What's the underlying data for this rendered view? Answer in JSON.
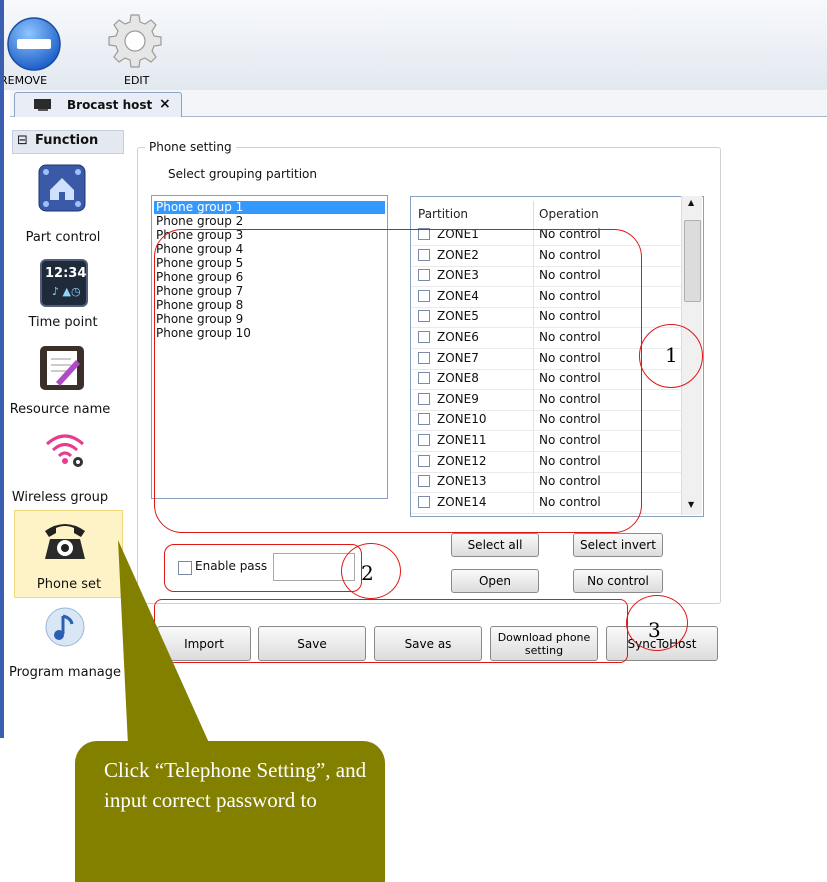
{
  "toolbar": {
    "remove_label": "REMOVE",
    "edit_label": "EDIT"
  },
  "tab": {
    "title": "Brocast host",
    "close": "×"
  },
  "sidebar": {
    "header": "Function",
    "collapse_symbol": "⊟",
    "items": [
      {
        "label": "Part control",
        "icon": "house-network-icon"
      },
      {
        "label": "Time point",
        "icon": "clock-icon",
        "clock_text": "12:34"
      },
      {
        "label": "Resource name",
        "icon": "notepad-icon"
      },
      {
        "label": "Wireless group",
        "icon": "wireless-icon"
      },
      {
        "label": "Phone set",
        "icon": "telephone-icon"
      },
      {
        "label": "Program manage",
        "icon": "music-note-icon"
      }
    ]
  },
  "panel": {
    "legend": "Phone setting",
    "hint": "Select grouping partition",
    "groups": [
      "Phone group 1",
      "Phone group 2",
      "Phone group 3",
      "Phone group 4",
      "Phone group 5",
      "Phone group 6",
      "Phone group 7",
      "Phone group 8",
      "Phone group 9",
      "Phone group 10"
    ],
    "table": {
      "headers": [
        "Partition",
        "Operation"
      ],
      "rows": [
        {
          "zone": "ZONE1",
          "op": "No control"
        },
        {
          "zone": "ZONE2",
          "op": "No control"
        },
        {
          "zone": "ZONE3",
          "op": "No control"
        },
        {
          "zone": "ZONE4",
          "op": "No control"
        },
        {
          "zone": "ZONE5",
          "op": "No control"
        },
        {
          "zone": "ZONE6",
          "op": "No control"
        },
        {
          "zone": "ZONE7",
          "op": "No control"
        },
        {
          "zone": "ZONE8",
          "op": "No control"
        },
        {
          "zone": "ZONE9",
          "op": "No control"
        },
        {
          "zone": "ZONE10",
          "op": "No control"
        },
        {
          "zone": "ZONE11",
          "op": "No control"
        },
        {
          "zone": "ZONE12",
          "op": "No control"
        },
        {
          "zone": "ZONE13",
          "op": "No control"
        },
        {
          "zone": "ZONE14",
          "op": "No control"
        }
      ]
    },
    "select_all": "Select all",
    "select_invert": "Select invert",
    "open": "Open",
    "no_control": "No control",
    "enable_pass": "Enable pass"
  },
  "actions": {
    "import": "Import",
    "save": "Save",
    "save_as": "Save as",
    "download": "Download phone setting",
    "sync": "SyncToHost"
  },
  "annotations": {
    "n1": "1",
    "n2": "2",
    "n3": "3",
    "callout": "Click “Telephone Setting”, and input correct password to"
  },
  "colors": {
    "accent": "#3399ff",
    "annotation_red": "#e01616",
    "callout_bg": "#838000",
    "selected_sidebar": "#fdf3c6"
  }
}
